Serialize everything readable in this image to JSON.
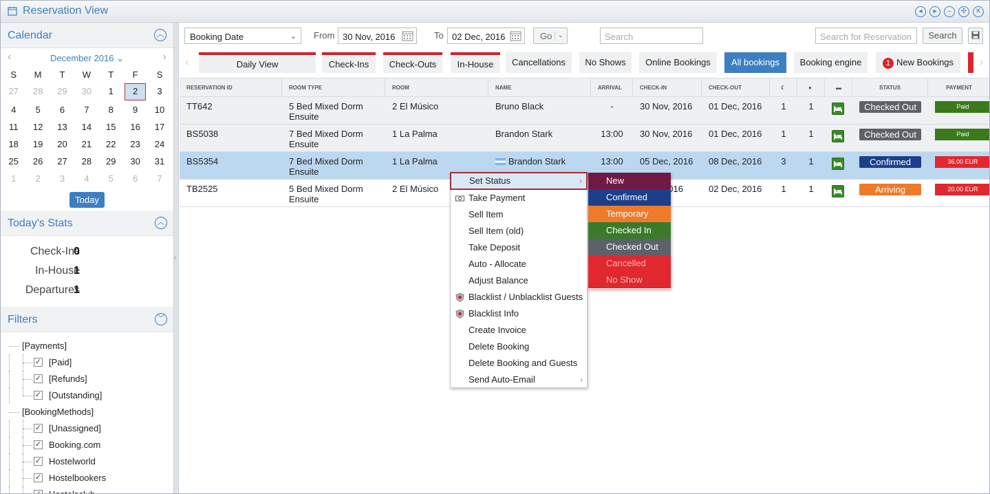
{
  "window": {
    "title": "Reservation View"
  },
  "calendar": {
    "section_title": "Calendar",
    "month": "December 2016",
    "dow": [
      "S",
      "M",
      "T",
      "W",
      "T",
      "F",
      "S"
    ],
    "weeks": [
      [
        "27",
        "28",
        "29",
        "30",
        "1",
        "2",
        "3"
      ],
      [
        "4",
        "5",
        "6",
        "7",
        "8",
        "9",
        "10"
      ],
      [
        "11",
        "12",
        "13",
        "14",
        "15",
        "16",
        "17"
      ],
      [
        "18",
        "19",
        "20",
        "21",
        "22",
        "23",
        "24"
      ],
      [
        "25",
        "26",
        "27",
        "28",
        "29",
        "30",
        "31"
      ],
      [
        "1",
        "2",
        "3",
        "4",
        "5",
        "6",
        "7"
      ]
    ],
    "today_label": "Today"
  },
  "stats": {
    "section_title": "Today's Stats",
    "items": [
      {
        "label": "Check-Ins",
        "value": "0"
      },
      {
        "label": "In-House",
        "value": "1"
      },
      {
        "label": "Departures",
        "value": "1"
      }
    ]
  },
  "filters": {
    "section_title": "Filters",
    "groups": [
      {
        "label": "[Payments]",
        "items": [
          "[Paid]",
          "[Refunds]",
          "[Outstanding]"
        ]
      },
      {
        "label": "[BookingMethods]",
        "items": [
          "[Unassigned]",
          "Booking.com",
          "Hostelworld",
          "Hostelbookers",
          "Hostelsclub"
        ]
      }
    ]
  },
  "toolbar": {
    "date_type": "Booking Date",
    "from_label": "From",
    "from_date": "30 Nov, 2016",
    "to_label": "To",
    "to_date": "02 Dec, 2016",
    "go_label": "Go",
    "search_placeholder": "Search",
    "reservation_search_placeholder": "Search for Reservation",
    "search_button": "Search"
  },
  "tabs": [
    {
      "label": "Daily View"
    },
    {
      "label": "Check-Ins"
    },
    {
      "label": "Check-Outs"
    },
    {
      "label": "In-House"
    },
    {
      "label": "Cancellations"
    },
    {
      "label": "No Shows"
    },
    {
      "label": "Online Bookings"
    },
    {
      "label": "All bookings"
    },
    {
      "label": "Booking engine"
    },
    {
      "label": "New Bookings",
      "badge": "1"
    }
  ],
  "table": {
    "columns": [
      "RESERVATION ID",
      "ROOM TYPE",
      "ROOM",
      "NAME",
      "ARRIVAL",
      "CHECK-IN",
      "CHECK-OUT",
      "",
      "",
      "",
      "STATUS",
      "PAYMENT"
    ],
    "rows": [
      {
        "id": "TT642",
        "room_type": "5 Bed Mixed Dorm Ensuite",
        "room": "2 El Músico",
        "name": "Bruno Black",
        "arrival": "-",
        "checkin": "30 Nov, 2016",
        "checkout": "01 Dec, 2016",
        "nights": "1",
        "guests": "1",
        "status": "Checked Out",
        "status_color": "#5e6168",
        "payment": "Paid",
        "payment_color": "#3a7a1a"
      },
      {
        "id": "BS5038",
        "room_type": "7 Bed Mixed Dorm Ensuite",
        "room": "1 La Palma",
        "name": "Brandon Stark",
        "arrival": "13:00",
        "checkin": "30 Nov, 2016",
        "checkout": "01 Dec, 2016",
        "nights": "1",
        "guests": "1",
        "status": "Checked Out",
        "status_color": "#5e6168",
        "payment": "Paid",
        "payment_color": "#3a7a1a"
      },
      {
        "id": "BS5354",
        "room_type": "7 Bed Mixed Dorm Ensuite",
        "room": "1 La Palma",
        "name": "Brandon Stark",
        "arrival": "13:00",
        "checkin": "05 Dec, 2016",
        "checkout": "08 Dec, 2016",
        "nights": "3",
        "guests": "1",
        "status": "Confirmed",
        "status_color": "#1d3f8a",
        "payment": "36.00 EUR",
        "payment_color": "#e0282e"
      },
      {
        "id": "TB2525",
        "room_type": "5 Bed Mixed Dorm Ensuite",
        "room": "2 El Músico",
        "name": "",
        "arrival": "",
        "checkin": "2016",
        "checkout": "02 Dec, 2016",
        "nights": "1",
        "guests": "1",
        "status": "Arriving",
        "status_color": "#ee7a2a",
        "payment": "20.00 EUR",
        "payment_color": "#e0282e"
      }
    ]
  },
  "context_menu": {
    "items": [
      "Set Status",
      "Take Payment",
      "Sell Item",
      "Sell Item (old)",
      "Take Deposit",
      "Auto - Allocate",
      "Adjust Balance",
      "Blacklist / Unblacklist Guests",
      "Blacklist Info",
      "Create Invoice",
      "Delete Booking",
      "Delete Booking and Guests",
      "Send Auto-Email"
    ]
  },
  "status_submenu": [
    {
      "label": "New",
      "color": "#6e1a45"
    },
    {
      "label": "Confirmed",
      "color": "#1d3f8a"
    },
    {
      "label": "Temporary",
      "color": "#ee7a2a"
    },
    {
      "label": "Checked In",
      "color": "#3a7a2a"
    },
    {
      "label": "Checked Out",
      "color": "#5e6168"
    },
    {
      "label": "Cancelled",
      "color": "#e0282e"
    },
    {
      "label": "No Show",
      "color": "#e0282e"
    }
  ],
  "colors": {
    "accent": "#3d7fc1",
    "tab_marker": "#c8262e"
  }
}
